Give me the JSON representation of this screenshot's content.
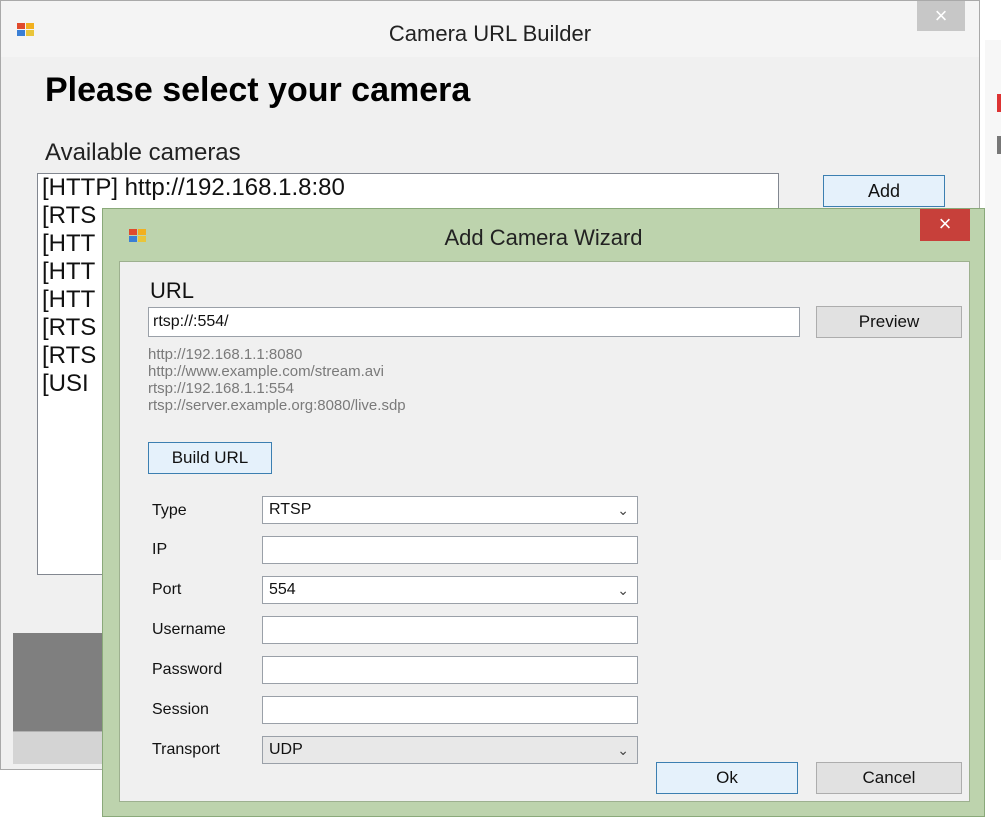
{
  "back_window": {
    "title": "Camera URL Builder",
    "close_glyph": "×",
    "heading": "Please select your camera",
    "available_label": "Available cameras",
    "cameras": [
      "[HTTP] http://192.168.1.8:80",
      "[RTS",
      "[HTT",
      "[HTT",
      "[HTT",
      "[RTS",
      "[RTS",
      "[USI"
    ],
    "add_label": "Add"
  },
  "wizard": {
    "title": "Add Camera Wizard",
    "close_glyph": "×",
    "url_label": "URL",
    "url_value": "rtsp://:554/",
    "preview_label": "Preview",
    "examples": [
      "http://192.168.1.1:8080",
      "http://www.example.com/stream.avi",
      "rtsp://192.168.1.1:554",
      "rtsp://server.example.org:8080/live.sdp"
    ],
    "build_label": "Build URL",
    "fields": {
      "type_label": "Type",
      "type_value": "RTSP",
      "ip_label": "IP",
      "ip_value": "",
      "port_label": "Port",
      "port_value": "554",
      "username_label": "Username",
      "username_value": "",
      "password_label": "Password",
      "password_value": "",
      "session_label": "Session",
      "session_value": "",
      "transport_label": "Transport",
      "transport_value": "UDP"
    },
    "ok_label": "Ok",
    "cancel_label": "Cancel",
    "chevron_glyph": "⌄"
  },
  "colors": {
    "wizard_frame": "#bdd3ad",
    "close_active": "#c7403a",
    "focus_border": "#3c7fb1"
  },
  "icons": [
    "app-icon",
    "close-icon",
    "chevron-down-icon"
  ]
}
